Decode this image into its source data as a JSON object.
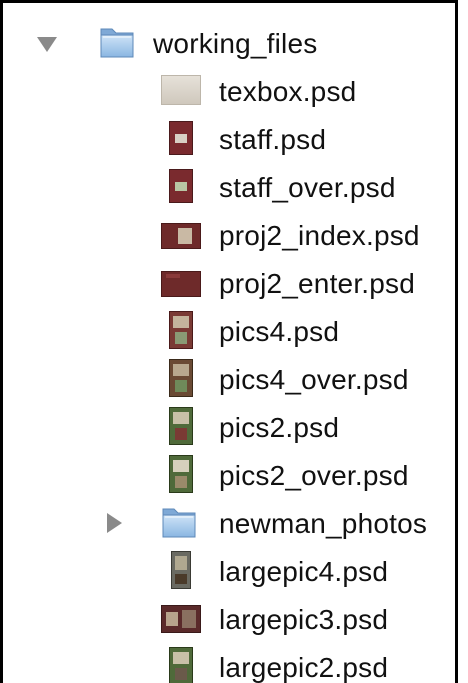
{
  "tree": {
    "root": {
      "name": "working_files",
      "icon": "folder-icon",
      "expanded": true
    },
    "items": [
      {
        "name": "texbox.psd",
        "icon": "psd-thumb-texbox-icon",
        "thumb_color": "#d9d4cb"
      },
      {
        "name": "staff.psd",
        "icon": "psd-thumb-staff-icon",
        "thumb_color": "#7a2a2e"
      },
      {
        "name": "staff_over.psd",
        "icon": "psd-thumb-staff-over-icon",
        "thumb_color": "#7a2a2e"
      },
      {
        "name": "proj2_index.psd",
        "icon": "psd-thumb-proj2-index-icon",
        "thumb_color": "#6e2a2a"
      },
      {
        "name": "proj2_enter.psd",
        "icon": "psd-thumb-proj2-enter-icon",
        "thumb_color": "#6e2a2a"
      },
      {
        "name": "pics4.psd",
        "icon": "psd-thumb-pics4-icon",
        "thumb_color": "#7a3a34"
      },
      {
        "name": "pics4_over.psd",
        "icon": "psd-thumb-pics4-over-icon",
        "thumb_color": "#6a4a34"
      },
      {
        "name": "pics2.psd",
        "icon": "psd-thumb-pics2-icon",
        "thumb_color": "#4f6a3a"
      },
      {
        "name": "pics2_over.psd",
        "icon": "psd-thumb-pics2-over-icon",
        "thumb_color": "#4f6a3a"
      },
      {
        "name": "newman_photos",
        "icon": "folder-icon",
        "is_folder": true,
        "expanded": false
      },
      {
        "name": "largepic4.psd",
        "icon": "psd-thumb-largepic4-icon",
        "thumb_color": "#6a6a62"
      },
      {
        "name": "largepic3.psd",
        "icon": "psd-thumb-largepic3-icon",
        "thumb_color": "#5a2a2a"
      },
      {
        "name": "largepic2.psd",
        "icon": "psd-thumb-largepic2-icon",
        "thumb_color": "#4f6a3a"
      }
    ]
  },
  "colors": {
    "disclosure_triangle": "#8a8a8a",
    "folder_blue": "#9cc3ea",
    "text": "#111111"
  }
}
